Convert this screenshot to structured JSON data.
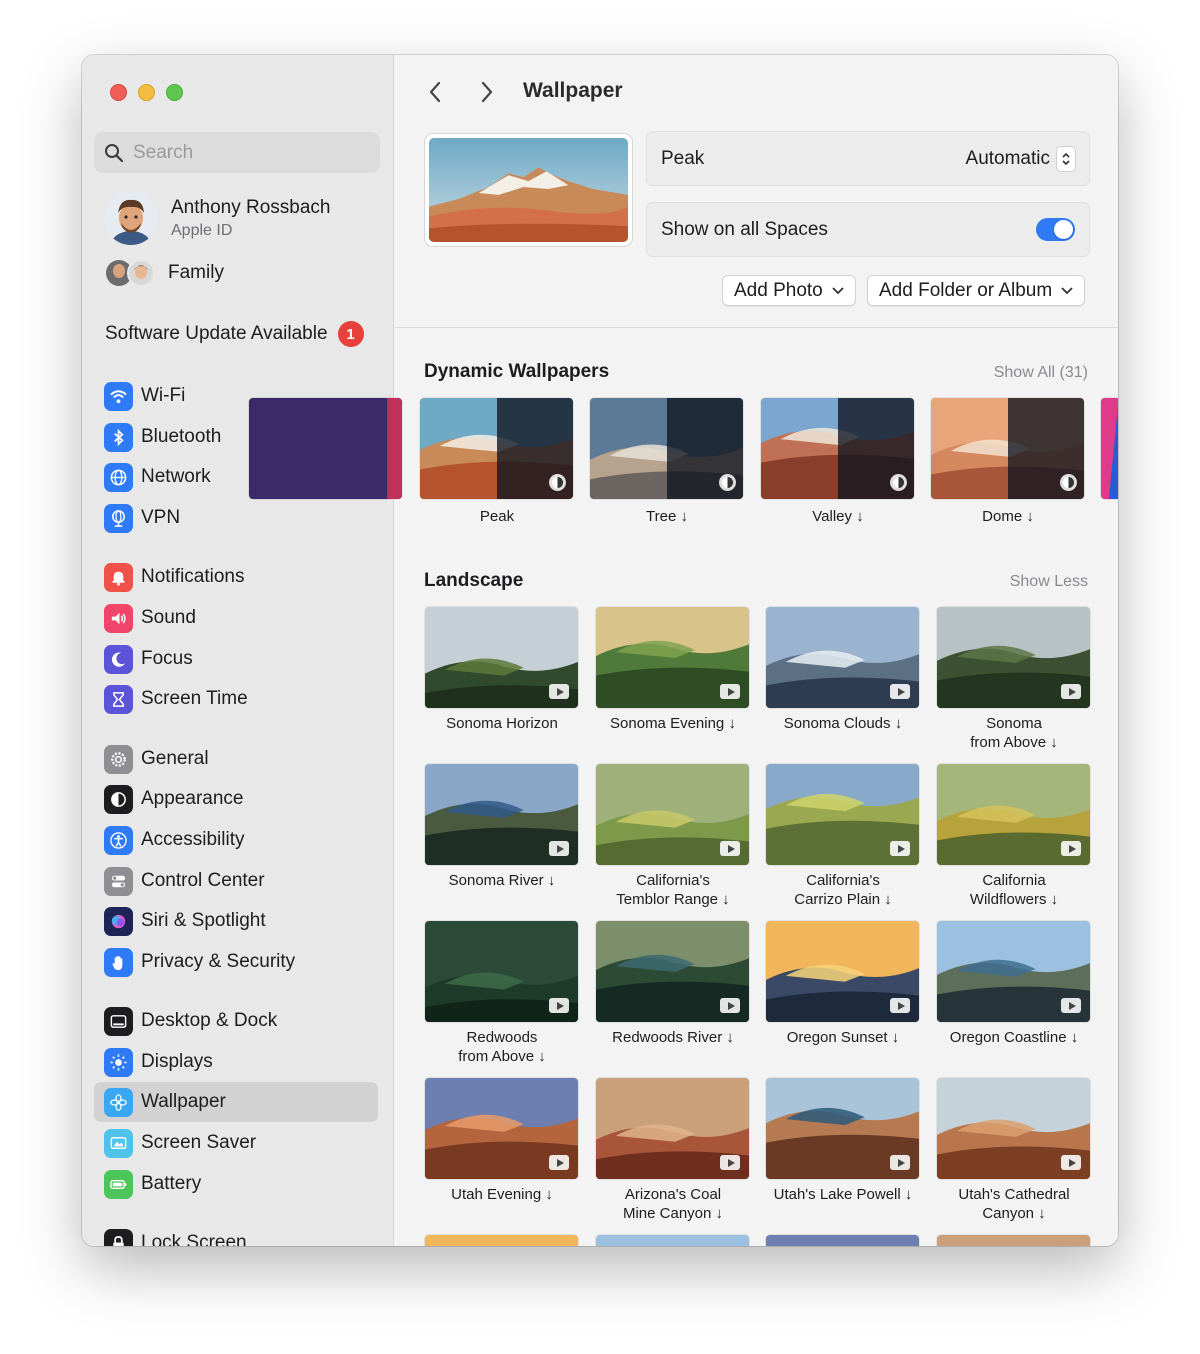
{
  "window": {
    "traffic_lights": [
      "close",
      "minimize",
      "zoom"
    ]
  },
  "sidebar": {
    "search_placeholder": "Search",
    "account": {
      "name": "Anthony Rossbach",
      "subtitle": "Apple ID"
    },
    "family_label": "Family",
    "update": {
      "label": "Software Update Available",
      "badge": "1"
    },
    "items": [
      {
        "label": "Wi-Fi",
        "icon": "wifi-icon",
        "color": "#2f7bf6"
      },
      {
        "label": "Bluetooth",
        "icon": "bluetooth-icon",
        "color": "#2f7bf6"
      },
      {
        "label": "Network",
        "icon": "globe-icon",
        "color": "#2f7bf6"
      },
      {
        "label": "VPN",
        "icon": "vpn-globe-icon",
        "color": "#2f7bf6"
      },
      {
        "label": "Notifications",
        "icon": "bell-icon",
        "color": "#f05148"
      },
      {
        "label": "Sound",
        "icon": "speaker-icon",
        "color": "#f0446a"
      },
      {
        "label": "Focus",
        "icon": "moon-icon",
        "color": "#5b53d8"
      },
      {
        "label": "Screen Time",
        "icon": "hourglass-icon",
        "color": "#5b53d8"
      },
      {
        "label": "General",
        "icon": "gear-icon",
        "color": "#8e8e93"
      },
      {
        "label": "Appearance",
        "icon": "appearance-icon",
        "color": "#1d1d1f"
      },
      {
        "label": "Accessibility",
        "icon": "accessibility-icon",
        "color": "#2f7bf6"
      },
      {
        "label": "Control Center",
        "icon": "switches-icon",
        "color": "#8e8e93"
      },
      {
        "label": "Siri & Spotlight",
        "icon": "siri-icon",
        "color": "#2b2f6a"
      },
      {
        "label": "Privacy & Security",
        "icon": "hand-icon",
        "color": "#2f7bf6"
      },
      {
        "label": "Desktop & Dock",
        "icon": "dock-icon",
        "color": "#1d1d1f"
      },
      {
        "label": "Displays",
        "icon": "sun-icon",
        "color": "#2f7bf6"
      },
      {
        "label": "Wallpaper",
        "icon": "flower-icon",
        "color": "#3aa7f2"
      },
      {
        "label": "Screen Saver",
        "icon": "screensaver-icon",
        "color": "#4fc3e8"
      },
      {
        "label": "Battery",
        "icon": "battery-icon",
        "color": "#4cc65a"
      },
      {
        "label": "Lock Screen",
        "icon": "lock-icon",
        "color": "#1d1d1f"
      }
    ],
    "selected": "Wallpaper"
  },
  "main": {
    "title": "Wallpaper",
    "current": {
      "name": "Peak",
      "mode": "Automatic",
      "show_all_spaces_label": "Show on all Spaces",
      "show_all_spaces_on": true
    },
    "buttons": {
      "add_photo": "Add Photo",
      "add_folder": "Add Folder or Album"
    },
    "dynamic": {
      "title": "Dynamic Wallpapers",
      "link": "Show All (31)",
      "items": [
        {
          "label": "Peak"
        },
        {
          "label": "Tree ↓"
        },
        {
          "label": "Valley ↓"
        },
        {
          "label": "Dome ↓"
        }
      ]
    },
    "landscape": {
      "title": "Landscape",
      "link": "Show Less",
      "items": [
        {
          "label": "Sonoma Horizon"
        },
        {
          "label": "Sonoma Evening ↓"
        },
        {
          "label": "Sonoma Clouds ↓"
        },
        {
          "label": "Sonoma\nfrom Above ↓"
        },
        {
          "label": "Sonoma River ↓"
        },
        {
          "label": "California's\nTemblor Range ↓"
        },
        {
          "label": "California's\nCarrizo Plain ↓"
        },
        {
          "label": "California\nWildflowers ↓"
        },
        {
          "label": "Redwoods\nfrom Above ↓"
        },
        {
          "label": "Redwoods River ↓"
        },
        {
          "label": "Oregon Sunset ↓"
        },
        {
          "label": "Oregon Coastline ↓"
        },
        {
          "label": "Utah Evening ↓"
        },
        {
          "label": "Arizona's Coal\nMine Canyon ↓"
        },
        {
          "label": "Utah's Lake Powell ↓"
        },
        {
          "label": "Utah's Cathedral\nCanyon ↓"
        }
      ]
    }
  }
}
